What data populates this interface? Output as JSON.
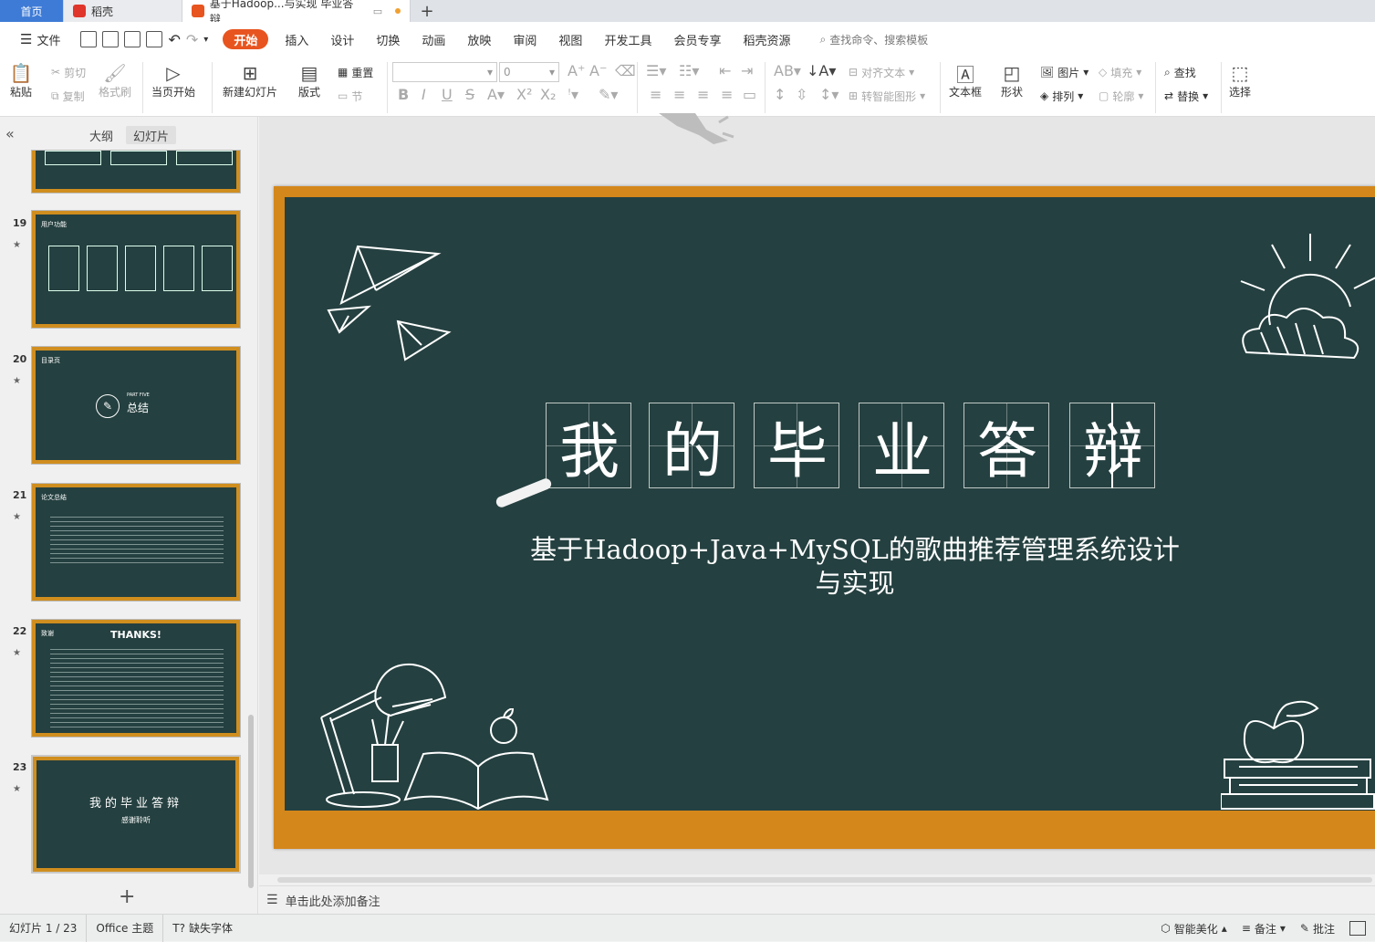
{
  "tabs": {
    "home": "首页",
    "docer": "稻壳",
    "active_doc": "基于Hadoop...与实现 毕业答辩",
    "new_tab": "+"
  },
  "menu": {
    "file": "文件",
    "items": [
      "开始",
      "插入",
      "设计",
      "切换",
      "动画",
      "放映",
      "审阅",
      "视图",
      "开发工具",
      "会员专享",
      "稻壳资源"
    ],
    "search_placeholder": "查找命令、搜索模板"
  },
  "ribbon": {
    "paste": "粘贴",
    "cut": "剪切",
    "copy": "复制",
    "format_painter": "格式刷",
    "play_from_current": "当页开始",
    "new_slide": "新建幻灯片",
    "layout": "版式",
    "reset": "重置",
    "section": "节",
    "font_size": "0",
    "align_text": "对齐文本",
    "smart_shape": "转智能图形",
    "textbox": "文本框",
    "shape": "形状",
    "picture": "图片",
    "arrange": "排列",
    "fill": "填充",
    "outline": "轮廓",
    "find": "查找",
    "replace": "替换",
    "select": "选择"
  },
  "left_panel": {
    "tab_outline": "大纲",
    "tab_slides": "幻灯片",
    "thumbs": [
      {
        "num": "19",
        "title": "用户功能"
      },
      {
        "num": "20",
        "title": "目录页",
        "center": "总结",
        "small": "PART FIVE"
      },
      {
        "num": "21",
        "title": "论文总结"
      },
      {
        "num": "22",
        "title": "致谢",
        "center": "THANKS!"
      },
      {
        "num": "23",
        "title": "",
        "center": "我的毕业答辩",
        "small": "感谢聆听"
      }
    ],
    "add": "+"
  },
  "slide": {
    "title_chars": [
      "我",
      "的",
      "毕",
      "业",
      "答",
      "辩"
    ],
    "subtitle_line1": "基于Hadoop+Java+MySQL的歌曲推荐管理系统设计",
    "subtitle_line2": "与实现"
  },
  "notes_placeholder": "单击此处添加备注",
  "status": {
    "slide_info": "幻灯片 1 / 23",
    "theme": "Office 主题",
    "missing_font": "缺失字体",
    "beautify": "智能美化",
    "notes": "备注",
    "comments": "批注"
  },
  "colors": {
    "board": "#254040",
    "frame": "#d4871b",
    "accent": "#e8541f"
  }
}
